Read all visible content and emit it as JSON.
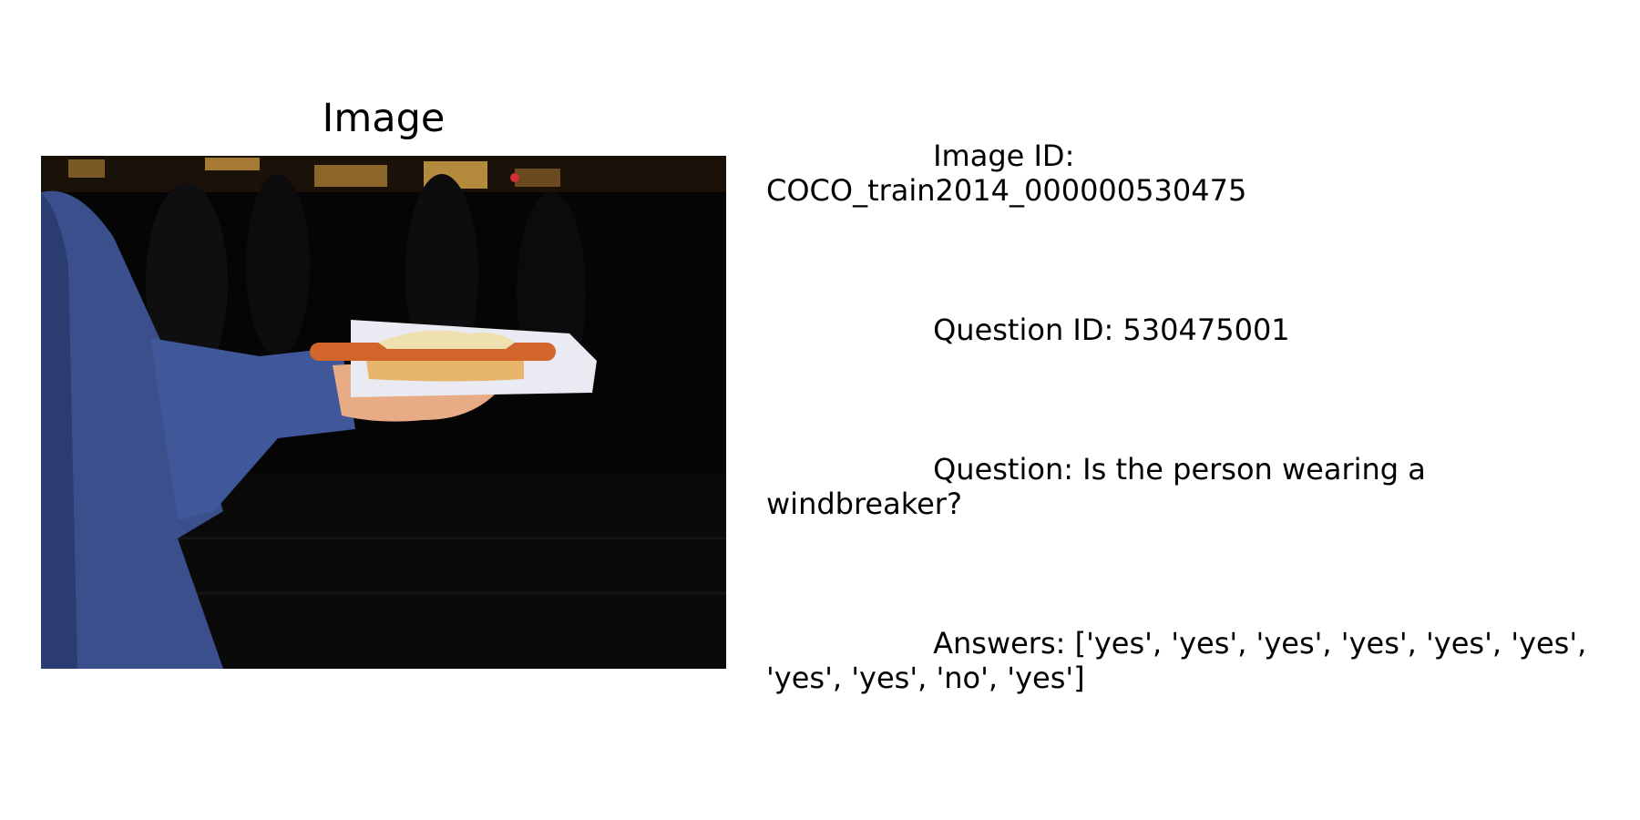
{
  "panel": {
    "title": "Image"
  },
  "photo": {
    "icon": "photo-hand-holding-hotdog",
    "colors": {
      "background": "#050505",
      "jacket": "#3a4f8c",
      "bread": "#e8b66a",
      "sausage": "#d2652c",
      "tray": "#e9eaf2",
      "skin": "#e7ab85"
    }
  },
  "info": {
    "image_id_label": "Image ID:",
    "image_id_value": "COCO_train2014_000000530475",
    "question_id": "Question ID: 530475001",
    "question": "Question: Is the person wearing a windbreaker?",
    "answers": "Answers: ['yes', 'yes', 'yes', 'yes', 'yes', 'yes', 'yes', 'yes', 'no', 'yes']"
  }
}
